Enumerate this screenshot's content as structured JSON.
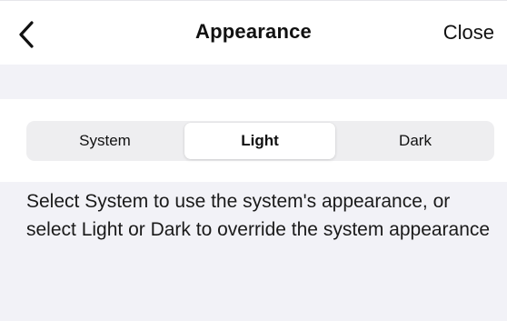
{
  "nav": {
    "back_icon": "chevron-left-icon",
    "title": "Appearance",
    "close_label": "Close"
  },
  "appearance": {
    "options": [
      "System",
      "Light",
      "Dark"
    ],
    "selected": "Light"
  },
  "description": "Select System to use the system's appearance, or select Light or Dark to override the system appearance",
  "colors": {
    "background": "#f2f2f7",
    "card": "#ffffff",
    "segment_track": "#eeeef0",
    "text": "#111111"
  }
}
